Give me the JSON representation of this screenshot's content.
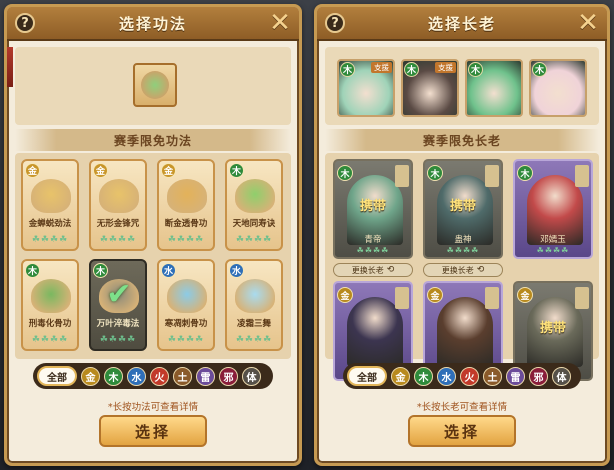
{
  "left_panel": {
    "title": "选择功法",
    "help_label": "?",
    "close_label": "✕",
    "section_title": "赛季限免功法",
    "cards": [
      {
        "element": "金",
        "name": "金蝉蜕劲法",
        "color": "#c9962a",
        "clovers": "☘☘☘☘",
        "art": "#e8c36a",
        "selected": false
      },
      {
        "element": "金",
        "name": "无形金锋咒",
        "color": "#c9962a",
        "clovers": "☘☘☘☘",
        "art": "#e8c36a",
        "selected": false
      },
      {
        "element": "金",
        "name": "断金透骨功",
        "color": "#c9962a",
        "clovers": "☘☘☘☘",
        "art": "#e3b25a",
        "selected": false
      },
      {
        "element": "木",
        "name": "天地同寿诀",
        "color": "#2f8a3b",
        "clovers": "☘☘☘☘",
        "art": "#8fcf6c",
        "selected": false
      },
      {
        "element": "木",
        "name": "刑毒化骨功",
        "color": "#2f8a3b",
        "clovers": "☘☘☘☘",
        "art": "#7ab860",
        "selected": false
      },
      {
        "element": "木",
        "name": "万叶淬毒法",
        "color": "#2f8a3b",
        "clovers": "☘☘☘☘",
        "art": "#8d8b7a",
        "selected": true
      },
      {
        "element": "水",
        "name": "寒凋刺骨功",
        "color": "#2f6fb8",
        "clovers": "☘☘☘☘",
        "art": "#8ccbe6",
        "selected": false
      },
      {
        "element": "水",
        "name": "凌霜三舞",
        "color": "#2f6fb8",
        "clovers": "☘☘☘☘",
        "art": "#a9dbef",
        "selected": false
      }
    ],
    "filter": {
      "all_label": "全部",
      "elements": [
        {
          "label": "金",
          "color": "#b88a1e"
        },
        {
          "label": "木",
          "color": "#2f8a3b"
        },
        {
          "label": "水",
          "color": "#2f6fb8"
        },
        {
          "label": "火",
          "color": "#c23a2a"
        },
        {
          "label": "土",
          "color": "#8a5a2a"
        },
        {
          "label": "雷",
          "color": "#6b4c9a"
        },
        {
          "label": "邪",
          "color": "#8a1e3a"
        },
        {
          "label": "体",
          "color": "#555048"
        }
      ]
    },
    "hint": "*长按功法可查看详情",
    "confirm_label": "选择"
  },
  "right_panel": {
    "title": "选择长老",
    "help_label": "?",
    "close_label": "✕",
    "section_title": "赛季限免长老",
    "avatars": [
      {
        "element": "木",
        "tag": "支援",
        "color": "#9fd3b8"
      },
      {
        "element": "木",
        "tag": "支援",
        "color": "#5a4a44"
      },
      {
        "element": "木",
        "tag": "",
        "color": "#6fc28c"
      },
      {
        "element": "木",
        "tag": "",
        "color": "#f0d3d8"
      }
    ],
    "elders": [
      {
        "element": "木",
        "el_color": "#2f8a3b",
        "carry": "携带",
        "name": "青帝",
        "style": "greyed",
        "figure": "#6fa58a",
        "clovers": "☘☘☘☘"
      },
      {
        "element": "木",
        "el_color": "#2f8a3b",
        "carry": "携带",
        "name": "蛊神",
        "style": "greyed",
        "figure": "#4f6b6a",
        "clovers": "☘☘☘☘"
      },
      {
        "element": "木",
        "el_color": "#2f8a3b",
        "carry": "",
        "name": "邓嫣玉",
        "style": "purple",
        "figure": "#c24a4a",
        "clovers": "☘☘☘☘"
      },
      {
        "element": "金",
        "el_color": "#b88a1e",
        "carry": "",
        "name": "",
        "style": "purple",
        "figure": "#3c3550",
        "clovers": ""
      },
      {
        "element": "金",
        "el_color": "#b88a1e",
        "carry": "",
        "name": "",
        "style": "purple",
        "figure": "#5a3e2e",
        "clovers": ""
      },
      {
        "element": "金",
        "el_color": "#b88a1e",
        "carry": "携带",
        "name": "",
        "style": "greyed",
        "figure": "#6a6a5a",
        "clovers": ""
      }
    ],
    "replace_label": "更换长老",
    "replace_icon": "⟲",
    "filter": {
      "all_label": "全部",
      "elements": [
        {
          "label": "金",
          "color": "#b88a1e"
        },
        {
          "label": "木",
          "color": "#2f8a3b"
        },
        {
          "label": "水",
          "color": "#2f6fb8"
        },
        {
          "label": "火",
          "color": "#c23a2a"
        },
        {
          "label": "土",
          "color": "#8a5a2a"
        },
        {
          "label": "雷",
          "color": "#6b4c9a"
        },
        {
          "label": "邪",
          "color": "#8a1e3a"
        },
        {
          "label": "体",
          "color": "#555048"
        }
      ]
    },
    "hint": "*长按长老可查看详情",
    "confirm_label": "选择"
  }
}
